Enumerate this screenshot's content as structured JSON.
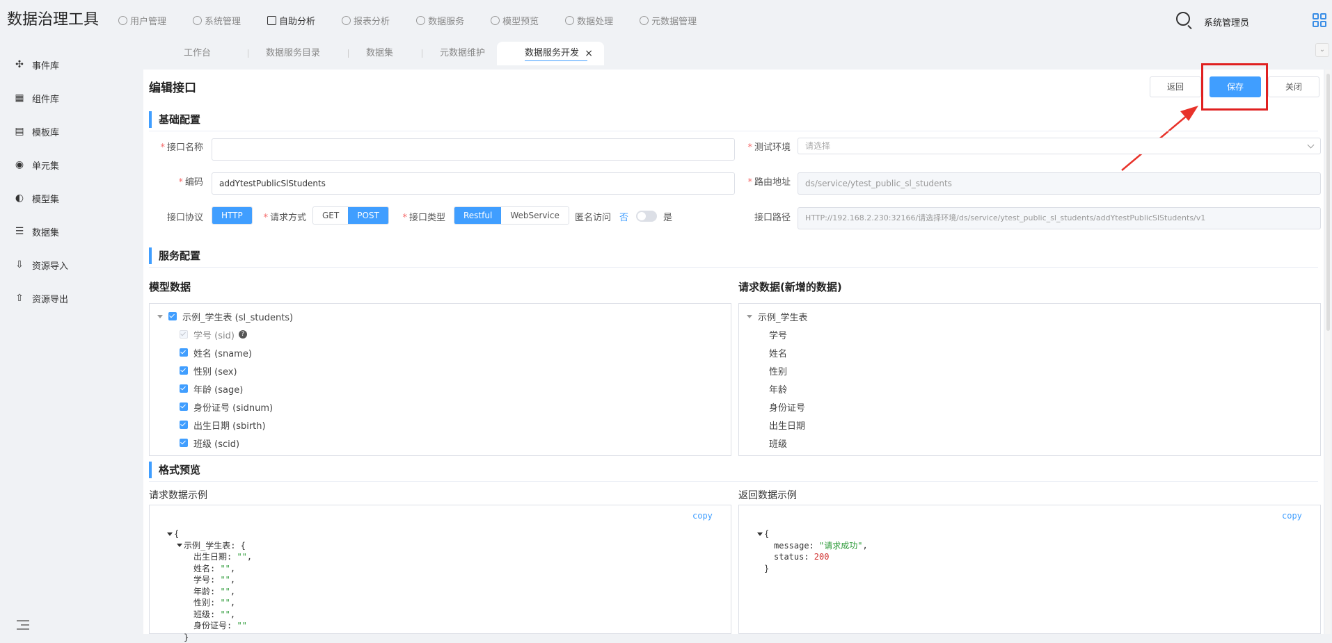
{
  "app_title": "数据治理工具",
  "top_nav": [
    {
      "label": "用户管理",
      "icon": "gear-icon",
      "active": false
    },
    {
      "label": "系统管理",
      "icon": "bar-chart-icon",
      "active": false
    },
    {
      "label": "自助分析",
      "icon": "bar-chart-icon",
      "active": true
    },
    {
      "label": "报表分析",
      "icon": "gear-icon",
      "active": false
    },
    {
      "label": "数据服务",
      "icon": "gear-icon",
      "active": false
    },
    {
      "label": "模型预览",
      "icon": "gear-icon",
      "active": false
    },
    {
      "label": "数据处理",
      "icon": "gear-icon",
      "active": false
    },
    {
      "label": "元数据管理",
      "icon": "gear-icon",
      "active": false
    }
  ],
  "user_name": "系统管理员",
  "tabs": [
    {
      "label": "工作台"
    },
    {
      "label": "数据服务目录"
    },
    {
      "label": "数据集"
    },
    {
      "label": "元数据维护"
    },
    {
      "label": "数据服务开发",
      "active": true,
      "close": "×"
    }
  ],
  "sidebar": [
    {
      "label": "事件库",
      "icon": "network-icon"
    },
    {
      "label": "组件库",
      "icon": "grid-icon"
    },
    {
      "label": "模板库",
      "icon": "template-icon"
    },
    {
      "label": "单元集",
      "icon": "circle-icon"
    },
    {
      "label": "模型集",
      "icon": "model-icon"
    },
    {
      "label": "数据集",
      "icon": "database-icon"
    },
    {
      "label": "资源导入",
      "icon": "import-icon"
    },
    {
      "label": "资源导出",
      "icon": "export-icon"
    }
  ],
  "page_title": "编辑接口",
  "buttons": {
    "back": "返回",
    "save": "保存",
    "close": "关闭"
  },
  "sections": {
    "basic": "基础配置",
    "service": "服务配置",
    "preview": "格式预览"
  },
  "form": {
    "name_label": "接口名称",
    "name_value": "",
    "env_label": "测试环境",
    "env_placeholder": "请选择",
    "code_label": "编码",
    "code_value": "addYtestPublicSlStudents",
    "route_label": "路由地址",
    "route_value": "ds/service/ytest_public_sl_students",
    "protocol_label": "接口协议",
    "protocol_value": "HTTP",
    "method_label": "请求方式",
    "method_options": [
      "GET",
      "POST"
    ],
    "method_selected": "POST",
    "type_label": "接口类型",
    "type_options": [
      "Restful",
      "WebService"
    ],
    "type_selected": "Restful",
    "anon_label": "匿名访问",
    "anon_no": "否",
    "anon_yes": "是",
    "anon_on": false,
    "path_label": "接口路径",
    "path_value": "HTTP://192.168.2.230:32166/请选择环境/ds/service/ytest_public_sl_students/addYtestPublicSlStudents/v1"
  },
  "model_data": {
    "title": "模型数据",
    "root": "示例_学生表 (sl_students)",
    "fields": [
      {
        "label": "学号 (sid)",
        "disabled": true,
        "help": "?"
      },
      {
        "label": "姓名 (sname)"
      },
      {
        "label": "性别 (sex)"
      },
      {
        "label": "年龄 (sage)"
      },
      {
        "label": "身份证号 (sidnum)"
      },
      {
        "label": "出生日期 (sbirth)"
      },
      {
        "label": "班级 (scid)"
      }
    ]
  },
  "request_data": {
    "title": "请求数据(新增的数据)",
    "root": "示例_学生表",
    "fields": [
      "学号",
      "姓名",
      "性别",
      "年龄",
      "身份证号",
      "出生日期",
      "班级"
    ]
  },
  "request_example": {
    "title": "请求数据示例",
    "copy": "copy",
    "lines": [
      {
        "indent": 0,
        "tri": true,
        "key": "{",
        "val": "",
        "cls": ""
      },
      {
        "indent": 1,
        "tri": true,
        "key": "示例_学生表: {",
        "val": "",
        "cls": ""
      },
      {
        "indent": 2,
        "tri": false,
        "key": "出生日期: ",
        "val": "\"\"",
        "suffix": ",",
        "cls": "str"
      },
      {
        "indent": 2,
        "tri": false,
        "key": "姓名: ",
        "val": "\"\"",
        "suffix": ",",
        "cls": "str"
      },
      {
        "indent": 2,
        "tri": false,
        "key": "学号: ",
        "val": "\"\"",
        "suffix": ",",
        "cls": "str"
      },
      {
        "indent": 2,
        "tri": false,
        "key": "年龄: ",
        "val": "\"\"",
        "suffix": ",",
        "cls": "str"
      },
      {
        "indent": 2,
        "tri": false,
        "key": "性别: ",
        "val": "\"\"",
        "suffix": ",",
        "cls": "str"
      },
      {
        "indent": 2,
        "tri": false,
        "key": "班级: ",
        "val": "\"\"",
        "suffix": ",",
        "cls": "str"
      },
      {
        "indent": 2,
        "tri": false,
        "key": "身份证号: ",
        "val": "\"\"",
        "suffix": "",
        "cls": "str"
      },
      {
        "indent": 1,
        "tri": false,
        "key": "}",
        "val": "",
        "cls": ""
      }
    ]
  },
  "response_example": {
    "title": "返回数据示例",
    "copy": "copy",
    "lines": [
      {
        "indent": 0,
        "tri": true,
        "key": "{",
        "val": "",
        "cls": ""
      },
      {
        "indent": 1,
        "tri": false,
        "key": "message: ",
        "val": "\"请求成功\"",
        "suffix": ",",
        "cls": "str"
      },
      {
        "indent": 1,
        "tri": false,
        "key": "status: ",
        "val": "200",
        "suffix": "",
        "cls": "num"
      },
      {
        "indent": 0,
        "tri": false,
        "key": "}",
        "val": "",
        "cls": ""
      }
    ]
  },
  "colors": {
    "accent": "#409eff",
    "highlight": "#e02020"
  }
}
